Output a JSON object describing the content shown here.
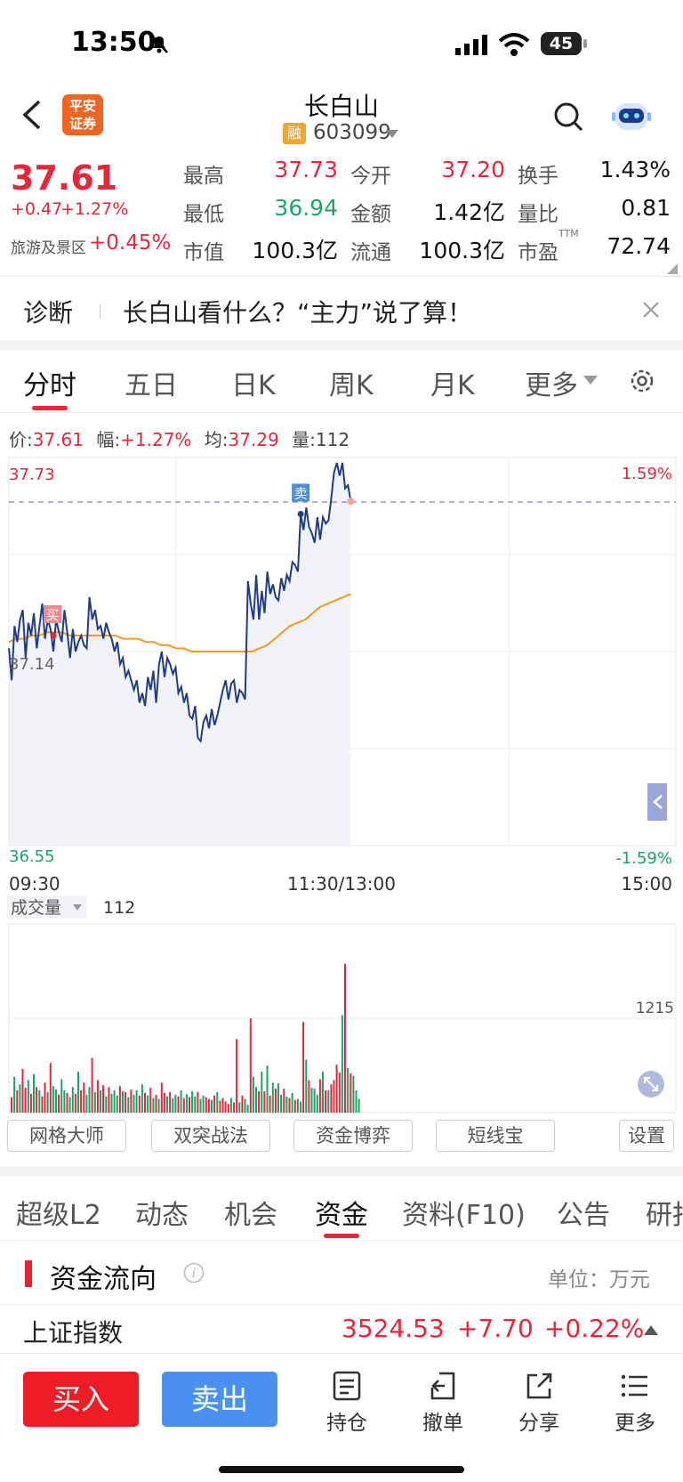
{
  "status": {
    "time": "13:50",
    "battery": "45"
  },
  "header": {
    "title": "长白山",
    "rong": "融",
    "code": "603099",
    "logo_line1": "平安",
    "logo_line2": "证券"
  },
  "quote": {
    "price": "37.61",
    "change": "+0.47",
    "change_pct": "+1.27%",
    "sector": "旅游及景区",
    "sector_pct": "+0.45%",
    "grid": [
      {
        "label": "最高",
        "value": "37.73"
      },
      {
        "label": "今开",
        "value": "37.20"
      },
      {
        "label": "换手",
        "value": "1.43%"
      },
      {
        "label": "最低",
        "value": "36.94"
      },
      {
        "label": "金额",
        "value": "1.42亿"
      },
      {
        "label": "量比",
        "value": "0.81"
      },
      {
        "label": "市值",
        "value": "100.3亿"
      },
      {
        "label": "流通",
        "value": "100.3亿"
      },
      {
        "label": "市盈",
        "value": "72.74"
      }
    ],
    "ttm": "TTM"
  },
  "diagnosis": {
    "label": "诊断",
    "text": "长白山看什么？“主力”说了算！"
  },
  "chart_tabs": [
    "分时",
    "五日",
    "日K",
    "周K",
    "月K",
    "更多"
  ],
  "info_line": {
    "price_label": "价:",
    "price": "37.61",
    "range_label": "幅:",
    "range": "+1.27%",
    "avg_label": "均:",
    "avg": "37.29",
    "vol_label": "量:",
    "vol": "112"
  },
  "chart_data": {
    "type": "line",
    "x_ticks": [
      "09:30",
      "11:30/13:00",
      "15:00"
    ],
    "y_left": {
      "top": "37.73",
      "mid": "37.14",
      "bottom": "36.55"
    },
    "y_right": {
      "top": "1.59%",
      "bottom": "-1.59%"
    },
    "ylim": [
      36.55,
      37.73
    ],
    "markers": [
      {
        "label": "买",
        "value": 37.19
      },
      {
        "label": "卖",
        "value": 37.61
      }
    ],
    "price": [
      37.15,
      37.05,
      37.22,
      37.17,
      37.24,
      37.27,
      37.12,
      37.23,
      37.19,
      37.26,
      37.15,
      37.22,
      37.29,
      37.18,
      37.24,
      37.21,
      37.14,
      37.24,
      37.2,
      37.17,
      37.27,
      37.2,
      37.12,
      37.21,
      37.14,
      37.17,
      37.19,
      37.16,
      37.15,
      37.31,
      37.24,
      37.27,
      37.21,
      37.22,
      37.18,
      37.23,
      37.2,
      37.18,
      37.14,
      37.17,
      37.1,
      37.12,
      37.06,
      37.08,
      37.05,
      37.02,
      37.05,
      36.98,
      37.01,
      36.97,
      37.06,
      37.02,
      37.08,
      36.98,
      37.1,
      37.14,
      37.06,
      37.12,
      37.1,
      37.07,
      37.09,
      37.01,
      37.03,
      36.98,
      37.01,
      36.94,
      36.93,
      36.97,
      36.87,
      36.86,
      36.92,
      36.94,
      36.9,
      36.96,
      36.91,
      36.94,
      36.98,
      37.02,
      37.05,
      36.99,
      37.04,
      37.05,
      36.98,
      37.02,
      37.01,
      36.99,
      37.36,
      37.29,
      37.24,
      37.38,
      37.24,
      37.33,
      37.26,
      37.39,
      37.32,
      37.35,
      37.31,
      37.3,
      37.37,
      37.33,
      37.38,
      37.36,
      37.42,
      37.41,
      37.39,
      37.57,
      37.52,
      37.59,
      37.53,
      37.51,
      37.48,
      37.56,
      37.49,
      37.56,
      37.54,
      37.55,
      37.62,
      37.7,
      37.73,
      37.69,
      37.73,
      37.65,
      37.66,
      37.61
    ],
    "avg": [
      37.17,
      37.18,
      37.18,
      37.19,
      37.19,
      37.2,
      37.2,
      37.2,
      37.19,
      37.19,
      37.19,
      37.19,
      37.19,
      37.19,
      37.19,
      37.18,
      37.18,
      37.18,
      37.17,
      37.17,
      37.16,
      37.16,
      37.15,
      37.15,
      37.14,
      37.14,
      37.14,
      37.14,
      37.14,
      37.14,
      37.14,
      37.14,
      37.14,
      37.15,
      37.16,
      37.18,
      37.2,
      37.22,
      37.23,
      37.24,
      37.26,
      37.28,
      37.29,
      37.3,
      37.31,
      37.32
    ],
    "volume": [
      180,
      420,
      260,
      330,
      510,
      290,
      380,
      220,
      450,
      300,
      260,
      190,
      350,
      240,
      580,
      310,
      270,
      210,
      390,
      260,
      230,
      180,
      300,
      220,
      480,
      260,
      350,
      210,
      300,
      640,
      240,
      380,
      260,
      320,
      190,
      300,
      220,
      260,
      200,
      310,
      250,
      240,
      180,
      270,
      210,
      260,
      200,
      330,
      230,
      200,
      290,
      170,
      210,
      160,
      350,
      230,
      190,
      240,
      170,
      210,
      190,
      260,
      170,
      220,
      180,
      250,
      190,
      240,
      160,
      200,
      180,
      160,
      150,
      200,
      240,
      140,
      170,
      130,
      100,
      170,
      120,
      860,
      120,
      200,
      160,
      90,
      1100,
      420,
      300,
      250,
      480,
      250,
      550,
      200,
      350,
      280,
      340,
      210,
      280,
      190,
      170,
      230,
      150,
      160,
      130,
      1060,
      620,
      380,
      290,
      280,
      210,
      390,
      480,
      260,
      260,
      330,
      380,
      560,
      470,
      1140,
      1740,
      520,
      460,
      430,
      260,
      160
    ],
    "volume_max_label": "1215",
    "volume_header": "成交量",
    "volume_value": "112"
  },
  "tools": [
    "网格大师",
    "双突战法",
    "资金博弈",
    "短线宝",
    "设置"
  ],
  "bottom_tabs": [
    "超级L2",
    "动态",
    "机会",
    "资金",
    "资料(F10)",
    "公告",
    "研报"
  ],
  "fund": {
    "title": "资金流向",
    "unit": "单位：万元"
  },
  "index": {
    "name": "上证指数",
    "value": "3524.53",
    "change": "+7.70",
    "pct": "+0.22%"
  },
  "actions": {
    "buy": "买入",
    "sell": "卖出",
    "items": [
      "持仓",
      "撤单",
      "分享",
      "更多"
    ]
  }
}
